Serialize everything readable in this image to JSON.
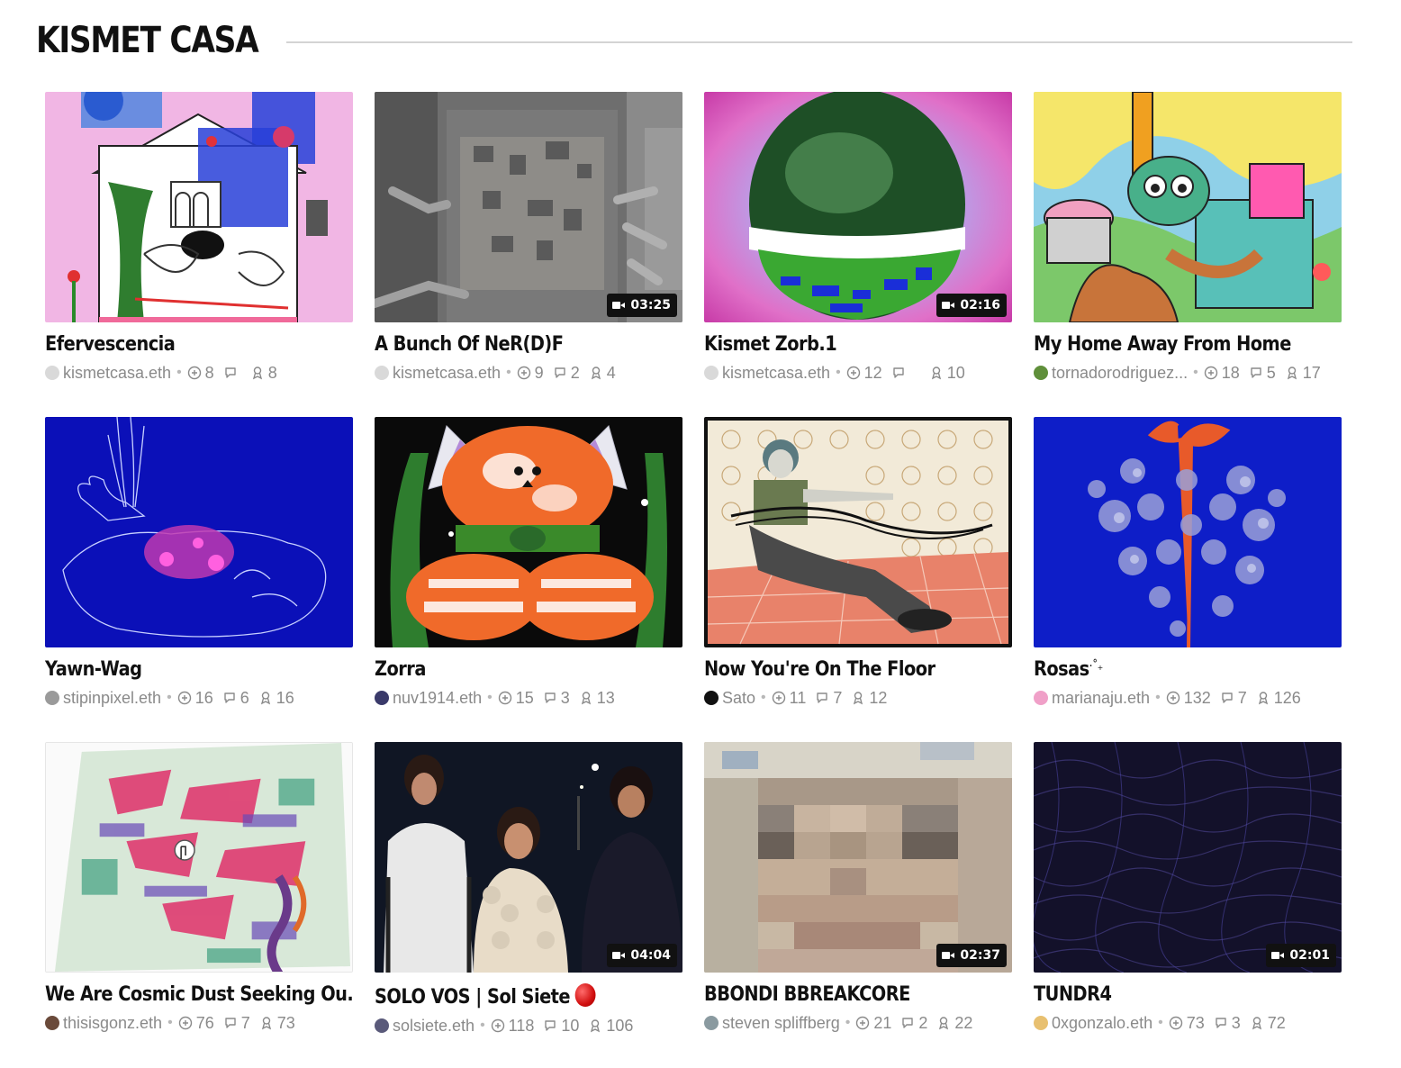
{
  "page": {
    "title": "KISMET CASA"
  },
  "cards": [
    {
      "title": "Efervescencia",
      "author": "kismetcasa.eth",
      "avatar_color": "#d9d9d9",
      "collects": "8",
      "comments": "",
      "editions": "8",
      "duration": ""
    },
    {
      "title": "A Bunch Of NeR(D)F",
      "author": "kismetcasa.eth",
      "avatar_color": "#d9d9d9",
      "collects": "9",
      "comments": "2",
      "editions": "4",
      "duration": "03:25"
    },
    {
      "title": "Kismet Zorb.1",
      "author": "kismetcasa.eth",
      "avatar_color": "#d9d9d9",
      "collects": "12",
      "comments": "",
      "editions": "10",
      "duration": "02:16"
    },
    {
      "title": "My Home Away From Home",
      "author": "tornadorodriguez...",
      "avatar_color": "#5f8f3a",
      "collects": "18",
      "comments": "5",
      "editions": "17",
      "duration": ""
    },
    {
      "title": "Yawn-Wag",
      "author": "stipinpixel.eth",
      "avatar_color": "#9a9a9a",
      "collects": "16",
      "comments": "6",
      "editions": "16",
      "duration": ""
    },
    {
      "title": "Zorra",
      "author": "nuv1914.eth",
      "avatar_color": "#3a3a6a",
      "collects": "15",
      "comments": "3",
      "editions": "13",
      "duration": ""
    },
    {
      "title": "Now You're On The Floor",
      "author": "Sato",
      "avatar_color": "#111111",
      "collects": "11",
      "comments": "7",
      "editions": "12",
      "duration": ""
    },
    {
      "title": "Rosas",
      "title_suffix": "·˚₊",
      "author": "marianaju.eth",
      "avatar_color": "#f0a0c8",
      "collects": "132",
      "comments": "7",
      "editions": "126",
      "duration": ""
    },
    {
      "title": "We Are Cosmic Dust Seeking Ou...",
      "author": "thisisgonz.eth",
      "avatar_color": "#6a4a3a",
      "collects": "76",
      "comments": "7",
      "editions": "73",
      "duration": ""
    },
    {
      "title": "SOLO VOS | Sol Siete",
      "author": "solsiete.eth",
      "avatar_color": "#5a5a7a",
      "collects": "118",
      "comments": "10",
      "editions": "106",
      "duration": "04:04",
      "has_emoji": true
    },
    {
      "title": "BBONDI BBREAKCORE",
      "author": "steven spliffberg",
      "avatar_color": "#8a9aa0",
      "collects": "21",
      "comments": "2",
      "editions": "22",
      "duration": "02:37"
    },
    {
      "title": "TUNDR4",
      "author": "0xgonzalo.eth",
      "avatar_color": "#e8c070",
      "collects": "73",
      "comments": "3",
      "editions": "72",
      "duration": "02:01"
    }
  ]
}
